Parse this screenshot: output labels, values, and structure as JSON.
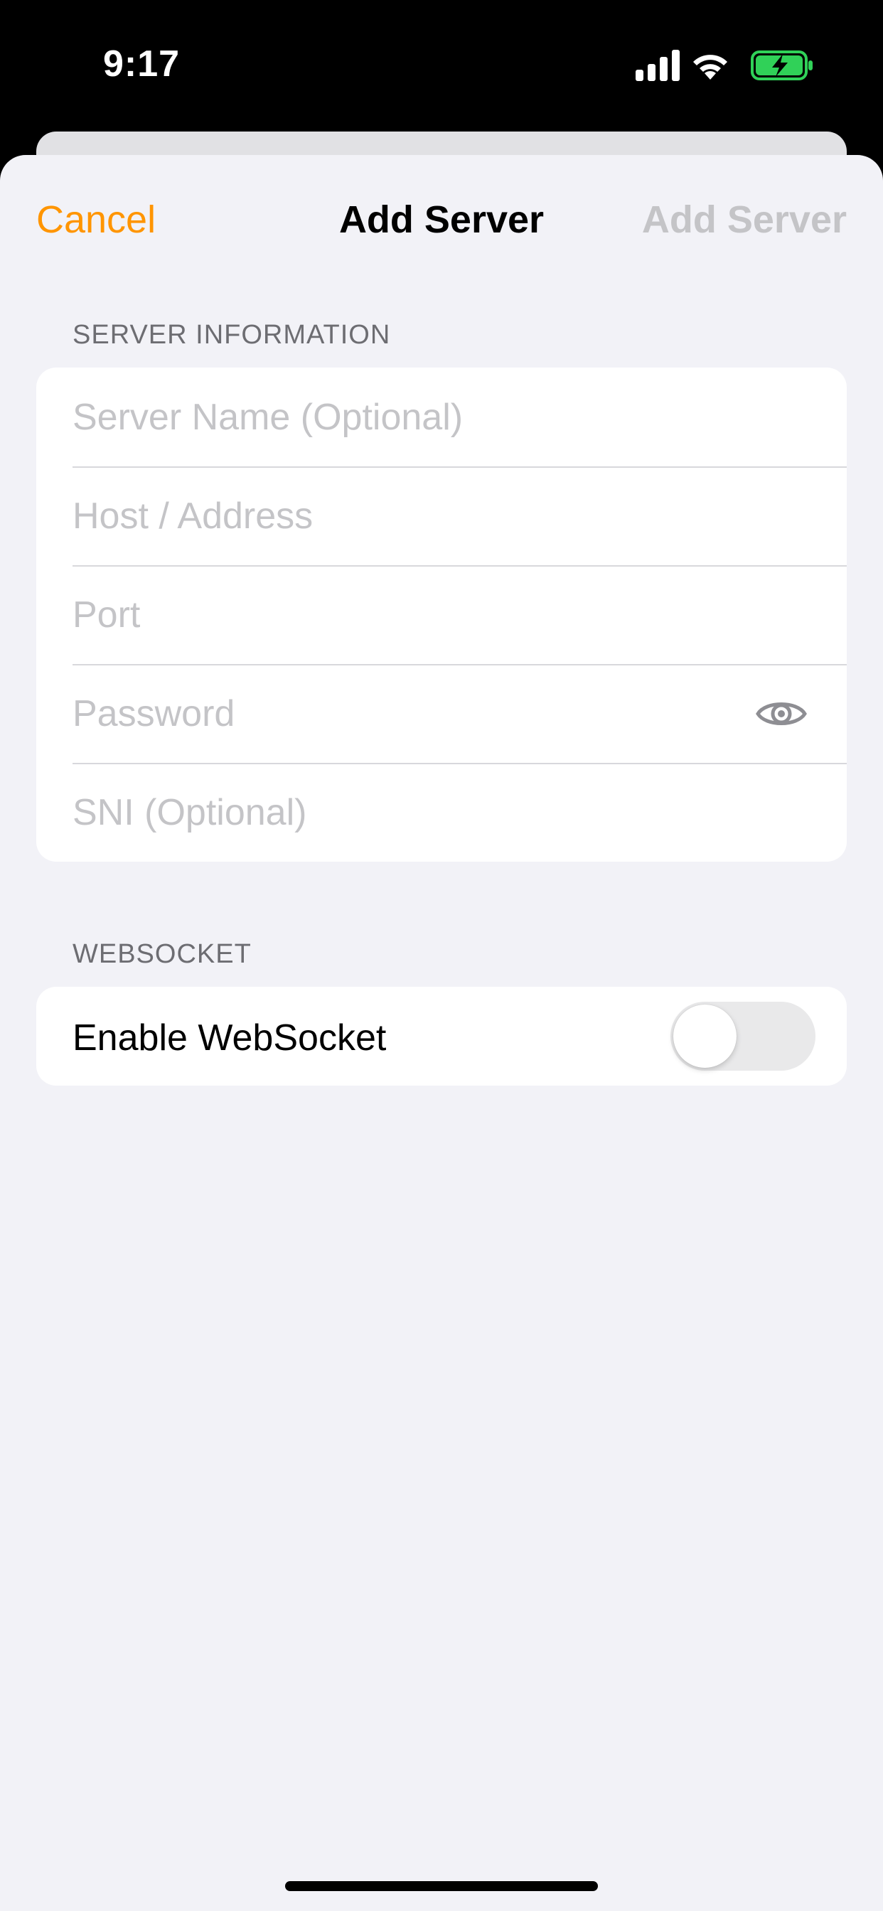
{
  "status_bar": {
    "time": "9:17",
    "icons": [
      "cellular-signal-icon",
      "wifi-icon",
      "battery-charging-icon"
    ],
    "battery_color": "#30d158"
  },
  "nav": {
    "cancel_label": "Cancel",
    "title": "Add Server",
    "add_label": "Add Server",
    "accent_color": "#ff9500",
    "add_disabled": true
  },
  "server_information": {
    "header": "SERVER INFORMATION",
    "fields": {
      "name": {
        "placeholder": "Server Name (Optional)",
        "value": ""
      },
      "host": {
        "placeholder": "Host / Address",
        "value": ""
      },
      "port": {
        "placeholder": "Port",
        "value": ""
      },
      "password": {
        "placeholder": "Password",
        "value": "",
        "reveal_icon": "eye-icon"
      },
      "sni": {
        "placeholder": "SNI (Optional)",
        "value": ""
      }
    }
  },
  "websocket": {
    "header": "WEBSOCKET",
    "enable_label": "Enable WebSocket",
    "enabled": false
  }
}
